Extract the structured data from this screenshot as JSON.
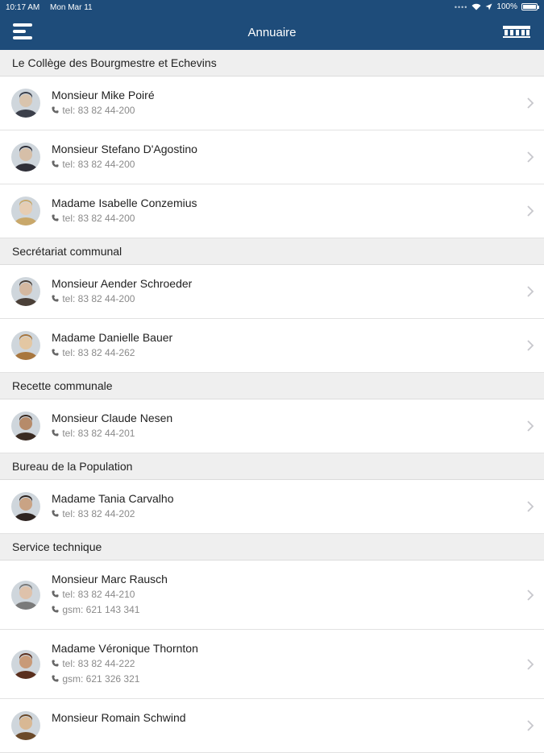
{
  "status_bar": {
    "time": "10:17 AM",
    "date": "Mon Mar 11",
    "battery": "100%"
  },
  "nav": {
    "title": "Annuaire"
  },
  "sections": [
    {
      "title": "Le Collège des Bourgmestre et Echevins",
      "contacts": [
        {
          "name": "Monsieur Mike Poiré",
          "tel": "tel: 83 82 44-200"
        },
        {
          "name": "Monsieur Stefano D'Agostino",
          "tel": "tel: 83 82 44-200"
        },
        {
          "name": "Madame Isabelle Conzemius",
          "tel": "tel: 83 82 44-200"
        }
      ]
    },
    {
      "title": "Secrétariat communal",
      "contacts": [
        {
          "name": "Monsieur Aender Schroeder",
          "tel": "tel: 83 82 44-200"
        },
        {
          "name": "Madame Danielle Bauer",
          "tel": "tel: 83 82 44-262"
        }
      ]
    },
    {
      "title": "Recette communale",
      "contacts": [
        {
          "name": "Monsieur Claude Nesen",
          "tel": "tel: 83 82 44-201"
        }
      ]
    },
    {
      "title": "Bureau de la Population",
      "contacts": [
        {
          "name": "Madame Tania Carvalho",
          "tel": "tel: 83 82 44-202"
        }
      ]
    },
    {
      "title": "Service technique",
      "contacts": [
        {
          "name": "Monsieur Marc Rausch",
          "tel": "tel: 83 82 44-210",
          "gsm": "gsm: 621 143 341"
        },
        {
          "name": "Madame Véronique Thornton",
          "tel": "tel: 83 82 44-222",
          "gsm": "gsm: 621 326 321"
        },
        {
          "name": "Monsieur Romain Schwind"
        }
      ]
    }
  ],
  "colors": {
    "nav_bg": "#1e4c7a",
    "section_bg": "#efefef"
  }
}
